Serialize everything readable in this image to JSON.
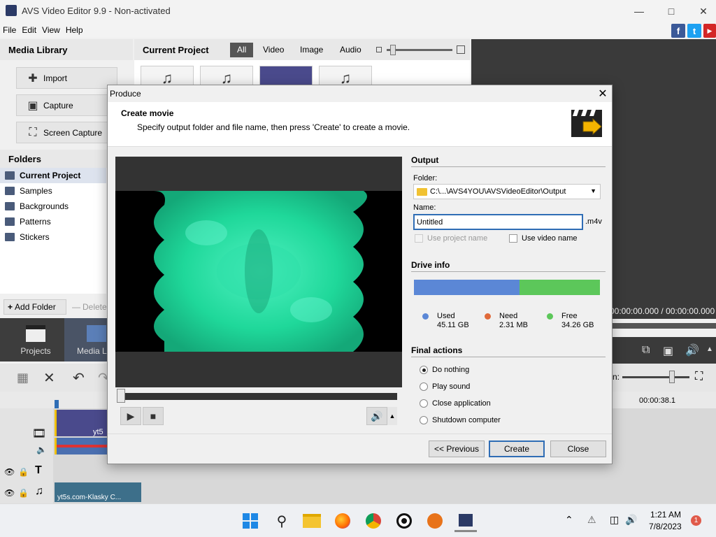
{
  "app": {
    "title": "AVS Video Editor 9.9 - Non-activated",
    "menu": [
      "File",
      "Edit",
      "View",
      "Help"
    ]
  },
  "social": {
    "facebook": "f",
    "twitter": "t",
    "other": "▶"
  },
  "media_library": {
    "header": "Media Library",
    "buttons": [
      "Import",
      "Capture",
      "Screen Capture"
    ]
  },
  "folders": {
    "header": "Folders",
    "items": [
      "Current Project",
      "Samples",
      "Backgrounds",
      "Patterns",
      "Stickers"
    ],
    "add_label": "Add Folder",
    "delete_label": "Delete"
  },
  "bottom_tabs": [
    "Projects",
    "Media Libr"
  ],
  "current_project": {
    "title": "Current Project",
    "tabs": [
      "All",
      "Video",
      "Image",
      "Audio"
    ]
  },
  "preview": {
    "time": "00:00:00.000 / 00:00:00.000",
    "timeline_time": "00:00:38.1",
    "zoom_label": "n:"
  },
  "timeline": {
    "clip1_label": "yt5",
    "clip2_label": "yt5s.com-Klasky C..."
  },
  "dialog": {
    "title": "Produce",
    "heading": "Create movie",
    "subheading": "Specify output folder and file name, then press 'Create' to create a movie.",
    "output": {
      "section": "Output",
      "folder_label": "Folder:",
      "folder_value": "C:\\...\\AVS4YOU\\AVSVideoEditor\\Output",
      "name_label": "Name:",
      "name_value": "Untitled",
      "extension": ".m4v",
      "use_project_name": "Use project name",
      "use_video_name": "Use video name"
    },
    "drive_info": {
      "section": "Drive info",
      "used_label": "Used",
      "used_value": "45.11 GB",
      "need_label": "Need",
      "need_value": "2.31 MB",
      "free_label": "Free",
      "free_value": "34.26 GB",
      "used_fraction": 0.568,
      "colors": {
        "used": "#5b87d6",
        "need": "#e06a3a",
        "free": "#5cc75a"
      }
    },
    "final_actions": {
      "section": "Final actions",
      "options": [
        "Do nothing",
        "Play sound",
        "Close application",
        "Shutdown computer"
      ],
      "selected": "Do nothing"
    },
    "buttons": {
      "previous": "<< Previous",
      "create": "Create",
      "close": "Close"
    }
  },
  "taskbar": {
    "time": "1:21 AM",
    "date": "7/8/2023",
    "badge": "1"
  }
}
